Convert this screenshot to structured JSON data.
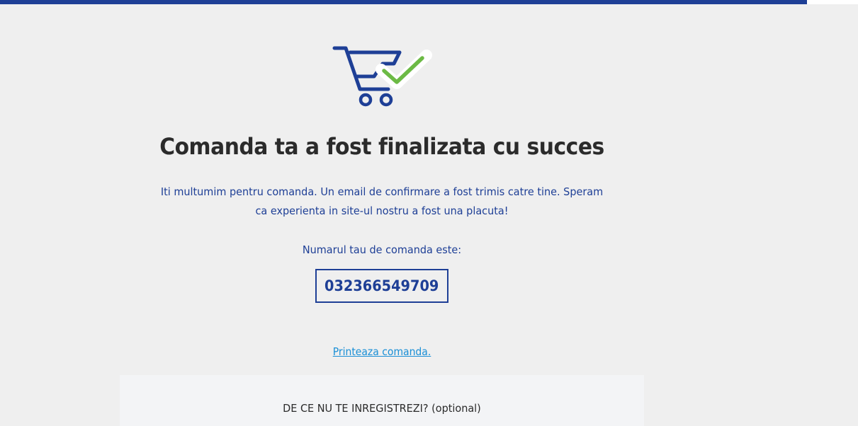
{
  "header": {
    "accent_color": "#1e3f96"
  },
  "icon": {
    "name": "shopping-cart-check-icon",
    "cart_color": "#1e3f96",
    "check_color": "#6cba45"
  },
  "confirmation": {
    "title": "Comanda ta a fost finalizata cu succes",
    "message_line1": "Iti multumim pentru comanda. Un email de confirmare a fost trimis catre tine. Speram",
    "message_line2": "ca experienta in site-ul nostru a fost una placuta!",
    "order_label": "Numarul tau de comanda este:",
    "order_number": "032366549709",
    "print_link": "Printeaza comanda."
  },
  "register": {
    "title": "DE CE NU TE INREGISTREZI? (optional)"
  }
}
